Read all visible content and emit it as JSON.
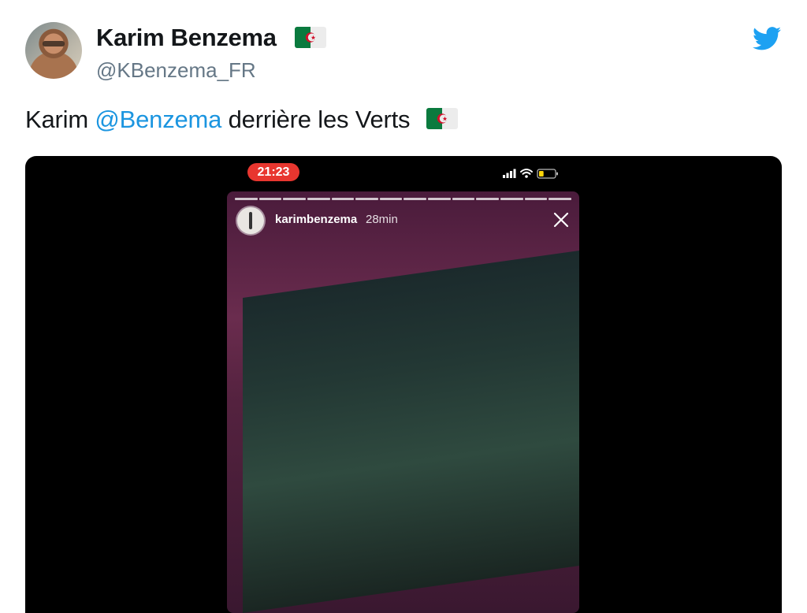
{
  "tweet": {
    "author_name": "Karim Benzema",
    "author_handle": "@KBenzema_FR",
    "text_before": "Karim ",
    "mention": "@Benzema",
    "text_after": " derrière les Verts"
  },
  "icons": {
    "flag": "algeria-flag-icon",
    "logo": "twitter-bird-icon"
  },
  "media": {
    "status_time": "21:23",
    "story_username": "karimbenzema",
    "story_age": "28min",
    "story_segments": 14,
    "battery_level": 0.3
  },
  "colors": {
    "mention": "#1b95e0",
    "twitter_blue": "#1da1f2",
    "time_pill": "#e8362f",
    "handle": "#657786",
    "flag_green": "#0a7a3e",
    "flag_red": "#d2102b",
    "battery": "#ffd60a"
  }
}
